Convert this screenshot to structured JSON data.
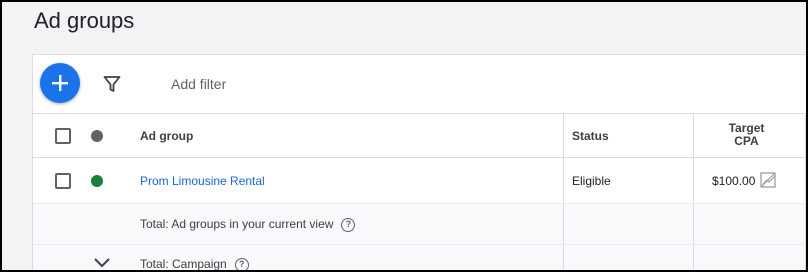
{
  "page": {
    "title": "Ad groups"
  },
  "toolbar": {
    "add_icon": "plus-icon",
    "filter_icon": "filter-icon",
    "add_filter_label": "Add filter"
  },
  "table": {
    "columns": {
      "ad_group": "Ad group",
      "status": "Status",
      "target_cpa_line1": "Target",
      "target_cpa_line2": "CPA"
    },
    "rows": [
      {
        "name": "Prom Limousine Rental",
        "status": "Eligible",
        "target_cpa": "$100.00",
        "status_color": "#188038"
      }
    ],
    "totals": {
      "current_view": "Total: Ad groups in your current view",
      "campaign": "Total: Campaign"
    }
  },
  "colors": {
    "accent": "#1a73e8",
    "link": "#1967d2",
    "enabled_dot": "#188038",
    "header_dot": "#5f6368"
  }
}
